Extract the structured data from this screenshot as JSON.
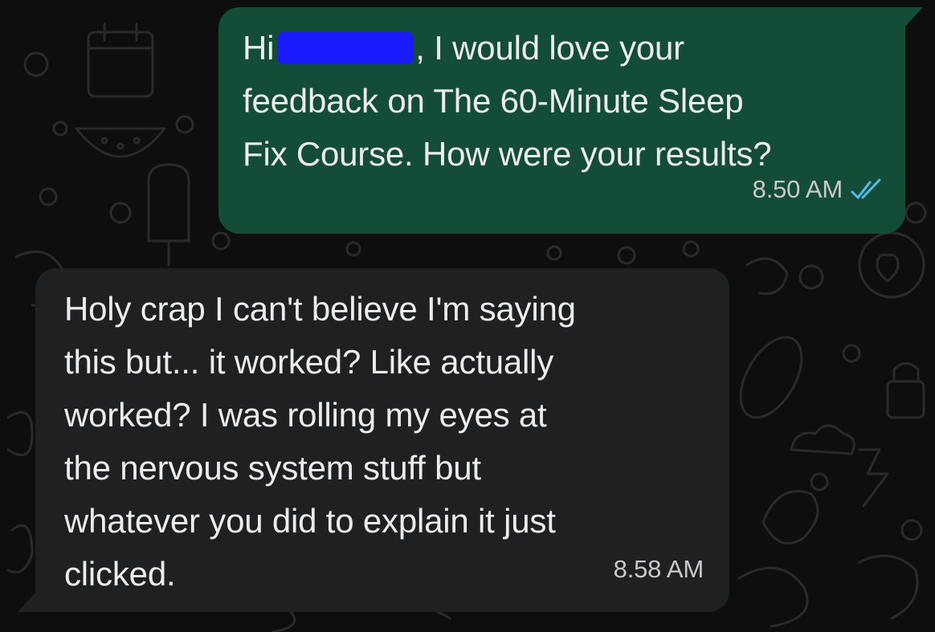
{
  "outgoing": {
    "greeting": "Hi",
    "text_after_redaction": ", I would love your",
    "line2": "feedback on The 60-Minute Sleep",
    "line3": "Fix Course. How were your results?",
    "time": "8.50 AM",
    "status_icon": "double-check-read-icon",
    "redaction_color": "#1a1cff"
  },
  "incoming": {
    "lines": [
      "Holy crap I can't believe I'm saying",
      "this but... it worked? Like actually",
      "worked? I was rolling my eyes at",
      "the nervous system stuff but",
      "whatever you did to explain it just",
      "clicked."
    ],
    "time": "8.58 AM"
  },
  "colors": {
    "outgoing_bubble": "#144d37",
    "incoming_bubble": "#1f2021",
    "background": "#0e0e0e",
    "read_ticks": "#53bdeb"
  }
}
